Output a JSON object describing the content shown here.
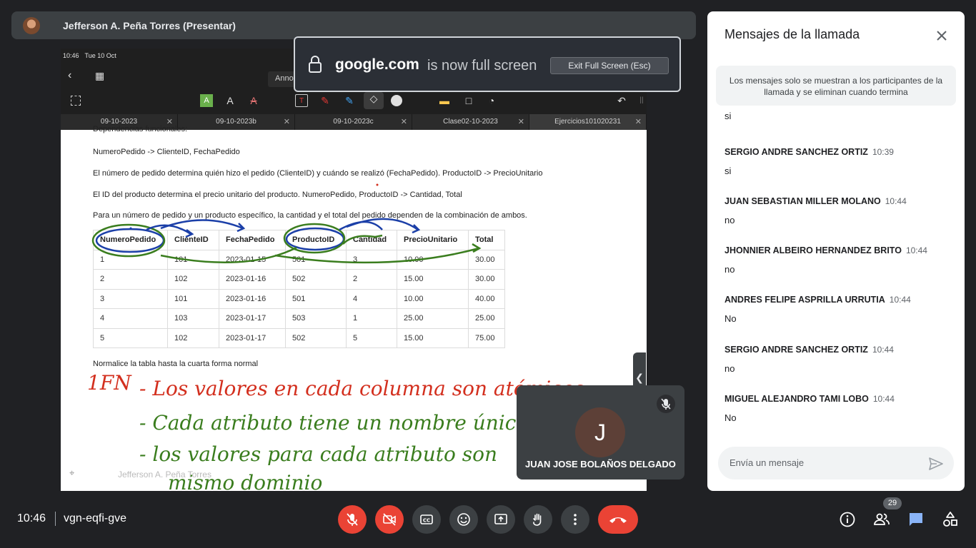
{
  "presenter": {
    "name": "Jefferson A. Peña Torres (Presentar)"
  },
  "ipad": {
    "time": "10:46",
    "date": "Tue 10 Oct",
    "annotate_tab": "Annotate",
    "tabs": [
      {
        "label": "09-10-2023"
      },
      {
        "label": "09-10-2023b"
      },
      {
        "label": "09-10-2023c"
      },
      {
        "label": "Clase02-10-2023"
      },
      {
        "label": "Ejercicios101020231"
      }
    ]
  },
  "document": {
    "heading_cut": "Dependencias funcionales:",
    "line1": "NumeroPedido -> ClienteID, FechaPedido",
    "line2": "El número de pedido determina quién hizo el pedido (ClienteID) y cuándo se realizó (FechaPedido). ProductoID -> PrecioUnitario",
    "line3": "El ID del producto determina el precio unitario del producto. NumeroPedido, ProductoID -> Cantidad, Total",
    "line4": "Para un número de pedido y un producto específico, la cantidad y el total del pedido dependen de la combinación de ambos.",
    "table": {
      "headers": [
        "NumeroPedido",
        "ClienteID",
        "FechaPedido",
        "ProductoID",
        "Cantidad",
        "PrecioUnitario",
        "Total"
      ],
      "rows": [
        [
          "1",
          "101",
          "2023-01-15",
          "501",
          "3",
          "10.00",
          "30.00"
        ],
        [
          "2",
          "102",
          "2023-01-16",
          "502",
          "2",
          "15.00",
          "30.00"
        ],
        [
          "3",
          "101",
          "2023-01-16",
          "501",
          "4",
          "10.00",
          "40.00"
        ],
        [
          "4",
          "103",
          "2023-01-17",
          "503",
          "1",
          "25.00",
          "25.00"
        ],
        [
          "5",
          "102",
          "2023-01-17",
          "502",
          "5",
          "15.00",
          "75.00"
        ]
      ]
    },
    "line5": "Normalice la tabla hasta la cuarta forma normal",
    "handwriting": {
      "label": "1FN",
      "item1": "- Los valores en cada columna son atómicos",
      "item2": "- Cada atributo tiene un nombre único",
      "item3": "- los valores para cada atributo son",
      "item3_cont": "mismo dominio"
    },
    "watermark": "Jefferson A. Peña Torres"
  },
  "fullscreen_notice": {
    "domain": "google.com",
    "text": "is now full screen",
    "exit_button": "Exit Full Screen (Esc)"
  },
  "tile": {
    "initial": "J",
    "name": "JUAN JOSE BOLAÑOS DELGADO"
  },
  "chat": {
    "title": "Mensajes de la llamada",
    "info": "Los mensajes solo se muestran a los participantes de la llamada y se eliminan cuando termina",
    "partial_message": "si",
    "messages": [
      {
        "sender": "SERGIO ANDRE SANCHEZ ORTIZ",
        "time": "10:39",
        "text": "si"
      },
      {
        "sender": "JUAN SEBASTIAN MILLER MOLANO",
        "time": "10:44",
        "text": "no"
      },
      {
        "sender": "JHONNIER ALBEIRO HERNANDEZ BRITO",
        "time": "10:44",
        "text": "no"
      },
      {
        "sender": "ANDRES FELIPE ASPRILLA URRUTIA",
        "time": "10:44",
        "text": "No"
      },
      {
        "sender": "SERGIO ANDRE SANCHEZ ORTIZ",
        "time": "10:44",
        "text": "no"
      },
      {
        "sender": "MIGUEL ALEJANDRO TAMI LOBO",
        "time": "10:44",
        "text": "No"
      }
    ],
    "input_placeholder": "Envía un mensaje"
  },
  "meeting": {
    "time": "10:46",
    "code": "vgn-eqfi-gve",
    "participants_count": "29"
  },
  "colors": {
    "background": "#202124",
    "end_call": "#ea4335",
    "accent_blue": "#1a73e8",
    "ink_red": "#d32f1e",
    "ink_green": "#3a7d1e",
    "ink_blue": "#1b3fa8"
  }
}
